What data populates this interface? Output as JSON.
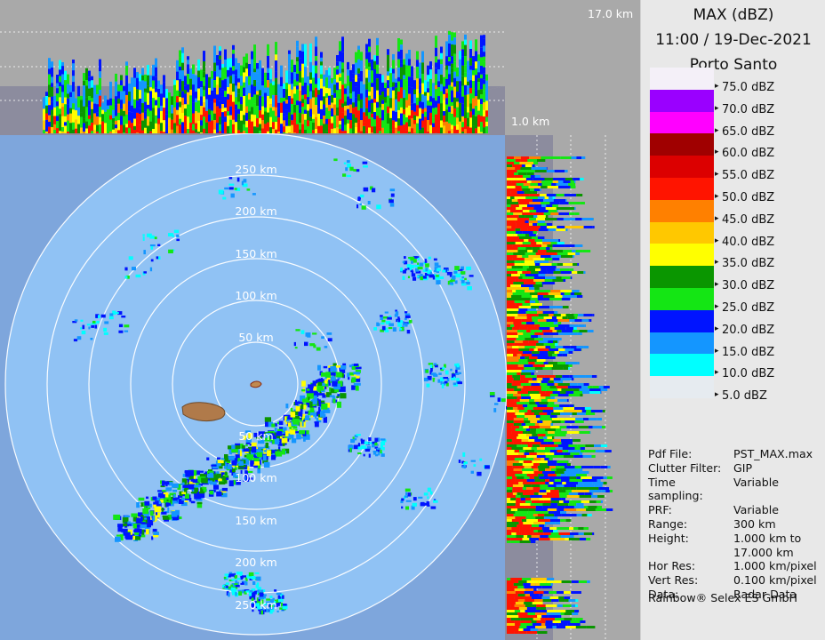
{
  "product": {
    "title": "MAX (dBZ)",
    "datetime": "11:00 / 19-Dec-2021",
    "site": "Porto Santo"
  },
  "height_labels": {
    "top_panel": "17.0 km",
    "side_panel": "1.0 km"
  },
  "range_rings": [
    "250 km",
    "200 km",
    "150 km",
    "100 km",
    "50 km"
  ],
  "range_rings_lower": [
    "50 km",
    "100 km",
    "150 km",
    "200 km",
    "250 km"
  ],
  "legend": [
    {
      "label": "75.0 dBZ",
      "color": "#f4f0f8"
    },
    {
      "label": "70.0 dBZ",
      "color": "#9a00ff"
    },
    {
      "label": "65.0 dBZ",
      "color": "#ff00ff"
    },
    {
      "label": "60.0 dBZ",
      "color": "#a00000"
    },
    {
      "label": "55.0 dBZ",
      "color": "#dc0000"
    },
    {
      "label": "50.0 dBZ",
      "color": "#ff1400"
    },
    {
      "label": "45.0 dBZ",
      "color": "#ff8000"
    },
    {
      "label": "40.0 dBZ",
      "color": "#ffc800"
    },
    {
      "label": "35.0 dBZ",
      "color": "#ffff00"
    },
    {
      "label": "30.0 dBZ",
      "color": "#0a9600"
    },
    {
      "label": "25.0 dBZ",
      "color": "#14e614"
    },
    {
      "label": "20.0 dBZ",
      "color": "#0014ff"
    },
    {
      "label": "15.0 dBZ",
      "color": "#1496ff"
    },
    {
      "label": "10.0 dBZ",
      "color": "#00ffff"
    },
    {
      "label": "5.0 dBZ",
      "color": "#e6ebf0"
    }
  ],
  "info": [
    {
      "key": "Pdf File:",
      "value": "PST_MAX.max"
    },
    {
      "key": "Clutter Filter:",
      "value": "GIP"
    },
    {
      "key": "Time sampling:",
      "value": "Variable"
    },
    {
      "key": "PRF:",
      "value": "Variable"
    },
    {
      "key": "Range:",
      "value": "300 km"
    },
    {
      "key": "Height:",
      "value": "1.000 km to\n17.000 km"
    },
    {
      "key": "Hor Res:",
      "value": "1.000 km/pixel"
    },
    {
      "key": "Vert Res:",
      "value": "0.100 km/pixel"
    },
    {
      "key": "Data:",
      "value": "Radar Data"
    }
  ],
  "footer": "Rainbow® Selex ES GmbH"
}
